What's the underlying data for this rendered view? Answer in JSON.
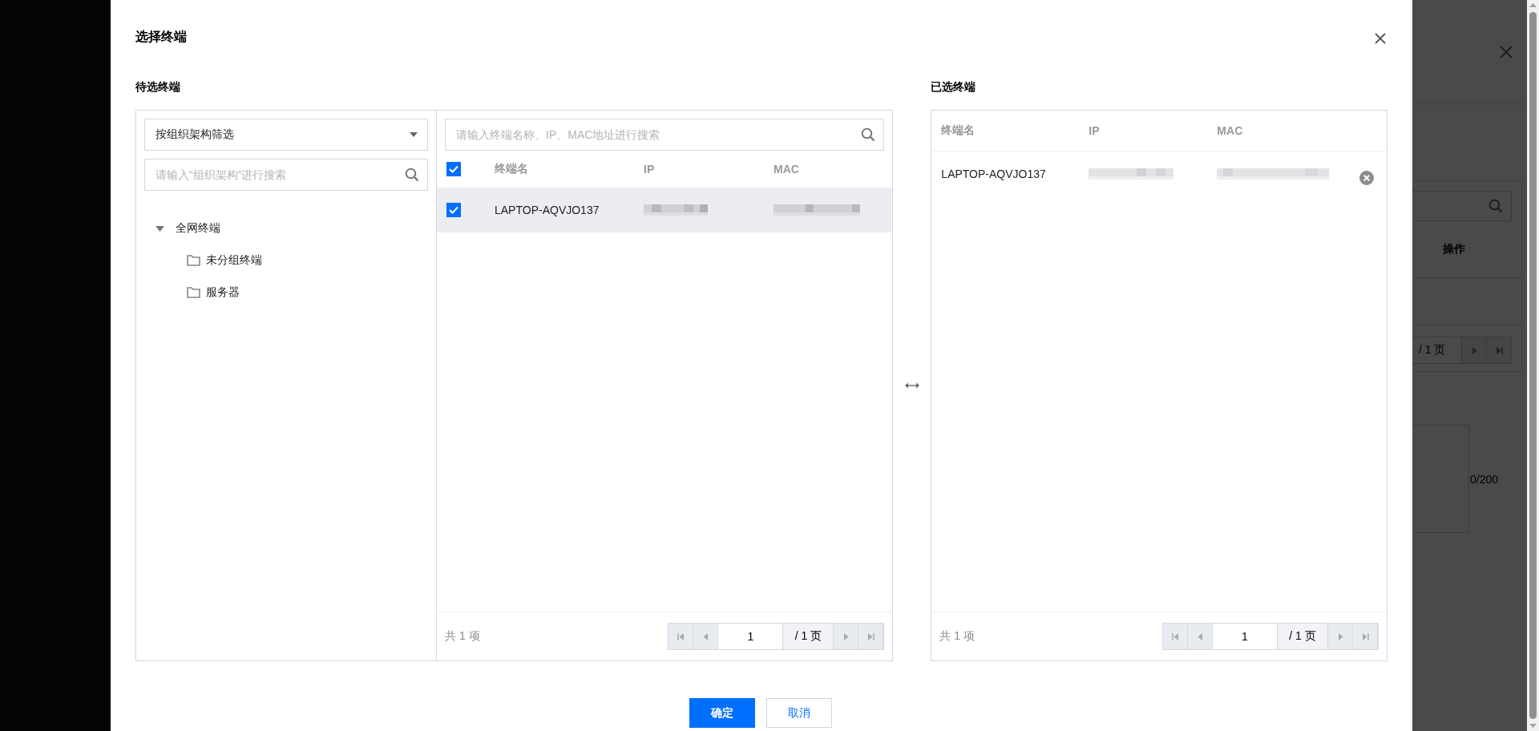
{
  "dialog": {
    "title": "选择终端",
    "candidates": {
      "label": "待选终端",
      "filter": {
        "value": "按组织架构筛选"
      },
      "tree_search": {
        "placeholder": "请输入“组织架构”进行搜索"
      },
      "tree": [
        {
          "label": "全网终端",
          "expanded": true,
          "children": [
            {
              "label": "未分组终端"
            },
            {
              "label": "服务器"
            }
          ]
        }
      ],
      "search": {
        "placeholder": "请输入终端名称、IP、MAC地址进行搜索"
      },
      "select_all": true,
      "columns": [
        "终端名",
        "IP",
        "MAC"
      ],
      "rows": [
        {
          "name": "LAPTOP-AQVJO137",
          "checked": true,
          "selected": true
        }
      ],
      "total": "共 1 项",
      "pager": {
        "page": "1",
        "pages": "/ 1 页"
      }
    },
    "chosen": {
      "label": "已选终端",
      "columns": [
        "终端名",
        "IP",
        "MAC"
      ],
      "rows": [
        {
          "name": "LAPTOP-AQVJO137"
        }
      ],
      "total": "共 1 项",
      "pager": {
        "page": "1",
        "pages": "/ 1 页"
      }
    },
    "buttons": [
      {
        "label": "确定",
        "kind": "primary"
      },
      {
        "label": "取消",
        "kind": "secondary"
      }
    ]
  },
  "background": {
    "column_1": "操作",
    "pages": "/ 1 页",
    "counter": "0/200"
  }
}
